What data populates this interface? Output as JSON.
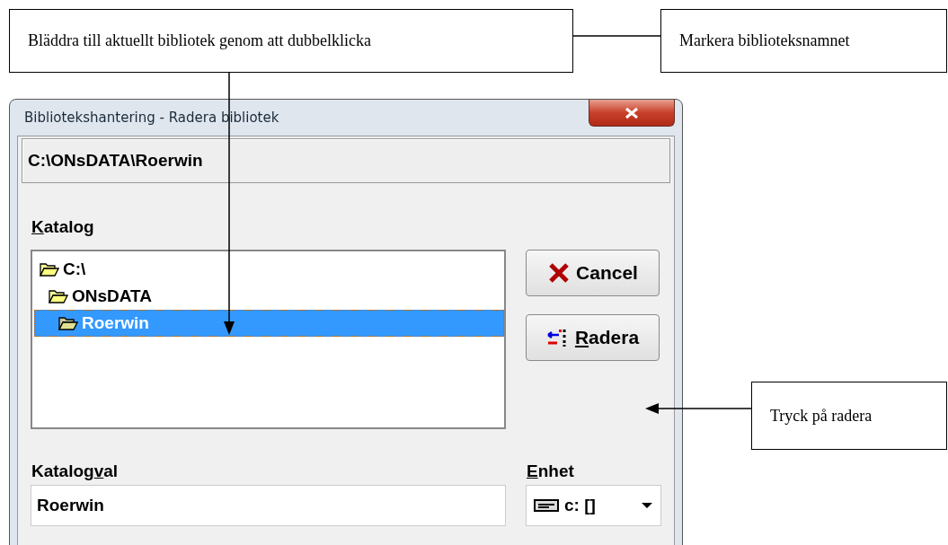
{
  "annotations": [
    {
      "text": "Bläddra till aktuellt bibliotek genom att dubbelklicka"
    },
    {
      "text": "Markera biblioteksnamnet"
    },
    {
      "text": "Tryck på radera"
    }
  ],
  "window": {
    "title": "Bibliotekshantering - Radera bibliotek"
  },
  "path": "C:\\ONsDATA\\Roerwin",
  "catalog": {
    "label": [
      {
        "text": "K",
        "underlined": true
      },
      {
        "text": "atalog",
        "underlined": false
      }
    ],
    "tree": [
      {
        "name": "C:\\",
        "selected": false,
        "children": [
          {
            "name": "ONsDATA",
            "selected": false,
            "children": [
              {
                "name": "Roerwin",
                "selected": true
              }
            ]
          }
        ]
      }
    ]
  },
  "buttons": [
    {
      "kind": "cancel",
      "label": [
        {
          "text": "Cancel",
          "underlined": false
        }
      ]
    },
    {
      "kind": "delete",
      "label": [
        {
          "text": "R",
          "underlined": true
        },
        {
          "text": "adera",
          "underlined": false
        }
      ]
    }
  ],
  "selection": {
    "label": [
      {
        "text": "Katalog",
        "underlined": false
      },
      {
        "text": "v",
        "underlined": true
      },
      {
        "text": "al",
        "underlined": false
      }
    ],
    "value": "Roerwin"
  },
  "drive": {
    "label": [
      {
        "text": "E",
        "underlined": true
      },
      {
        "text": "nhet",
        "underlined": false
      }
    ],
    "value": "c: []"
  }
}
